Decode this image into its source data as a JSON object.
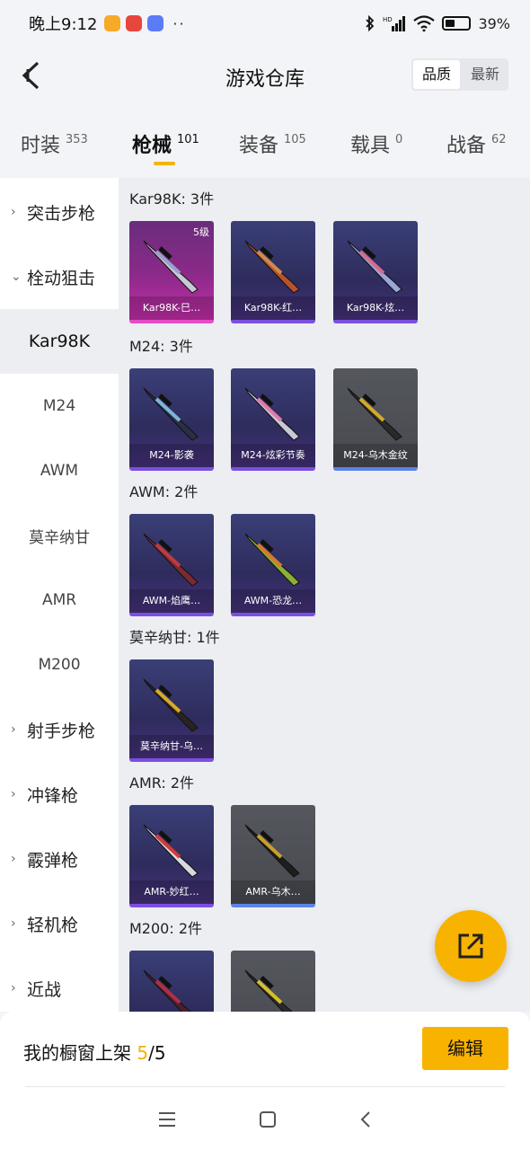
{
  "status": {
    "time": "晚上9:12",
    "apps": [
      {
        "name": "notes-app-icon",
        "color": "#f7a928"
      },
      {
        "name": "news-app-icon",
        "color": "#e8453c"
      },
      {
        "name": "gallery-app-icon",
        "color": "#5b7cf7"
      }
    ],
    "more": "··",
    "battery": "39%",
    "battery_level": 0.39
  },
  "header": {
    "title": "游戏仓库",
    "sort_quality": "品质",
    "sort_latest": "最新"
  },
  "tabs": [
    {
      "label": "时装",
      "count": "353"
    },
    {
      "label": "枪械",
      "count": "101"
    },
    {
      "label": "装备",
      "count": "105"
    },
    {
      "label": "载具",
      "count": "0"
    },
    {
      "label": "战备",
      "count": "62"
    }
  ],
  "sidebar": {
    "categories": [
      {
        "label": "突击步枪",
        "chev": "›"
      },
      {
        "label": "栓动狙击",
        "chev": "⌄"
      },
      {
        "label": "射手步枪",
        "chev": "›"
      },
      {
        "label": "冲锋枪",
        "chev": "›"
      },
      {
        "label": "霰弹枪",
        "chev": "›"
      },
      {
        "label": "轻机枪",
        "chev": "›"
      },
      {
        "label": "近战",
        "chev": "›"
      }
    ],
    "subs": [
      "Kar98K",
      "M24",
      "AWM",
      "莫辛纳甘",
      "AMR",
      "M200"
    ]
  },
  "groups": [
    {
      "title": "Kar98K: 3件",
      "cards": [
        {
          "name": "Kar98K-巳…",
          "style": "pink",
          "badge": "5级",
          "gun": "#c9c9d6",
          "accent": "#9aa0c8"
        },
        {
          "name": "Kar98K-红…",
          "style": "purple",
          "badge": "",
          "gun": "#b5532e",
          "accent": "#d08a4c"
        },
        {
          "name": "Kar98K-炫…",
          "style": "purple",
          "badge": "",
          "gun": "#9aa6d8",
          "accent": "#d46b8c"
        }
      ]
    },
    {
      "title": "M24: 3件",
      "cards": [
        {
          "name": "M24-影袭",
          "style": "purple",
          "badge": "",
          "gun": "#2b2f45",
          "accent": "#7fb5d8"
        },
        {
          "name": "M24-炫彩节奏",
          "style": "purple",
          "badge": "",
          "gun": "#c8c8d8",
          "accent": "#e07aa8"
        },
        {
          "name": "M24-乌木金纹",
          "style": "grey",
          "badge": "",
          "gun": "#2a2a2a",
          "accent": "#d6a92a"
        }
      ]
    },
    {
      "title": "AWM: 2件",
      "cards": [
        {
          "name": "AWM-焰鹰…",
          "style": "purple",
          "badge": "",
          "gun": "#7a2a32",
          "accent": "#c03a40"
        },
        {
          "name": "AWM-恐龙…",
          "style": "purple",
          "badge": "",
          "gun": "#8cae34",
          "accent": "#d67a2a"
        }
      ]
    },
    {
      "title": "莫辛纳甘: 1件",
      "cards": [
        {
          "name": "莫辛纳甘-乌…",
          "style": "purple",
          "badge": "",
          "gun": "#2a2420",
          "accent": "#d6a92a"
        }
      ]
    },
    {
      "title": "AMR: 2件",
      "cards": [
        {
          "name": "AMR-妙红…",
          "style": "purple",
          "badge": "",
          "gun": "#d8d8e0",
          "accent": "#d23a3a"
        },
        {
          "name": "AMR-乌木…",
          "style": "grey",
          "badge": "",
          "gun": "#1e1e1e",
          "accent": "#c9a02a"
        }
      ]
    },
    {
      "title": "M200: 2件",
      "cards": [
        {
          "name": "",
          "style": "purple",
          "badge": "",
          "gun": "#4a2030",
          "accent": "#b03040"
        },
        {
          "name": "",
          "style": "grey",
          "badge": "",
          "gun": "#2a2a2a",
          "accent": "#d6c02a"
        }
      ]
    }
  ],
  "bottom": {
    "showcase_label": "我的橱窗上架",
    "showcase_current": "5",
    "showcase_total": "/5",
    "edit": "编辑"
  }
}
